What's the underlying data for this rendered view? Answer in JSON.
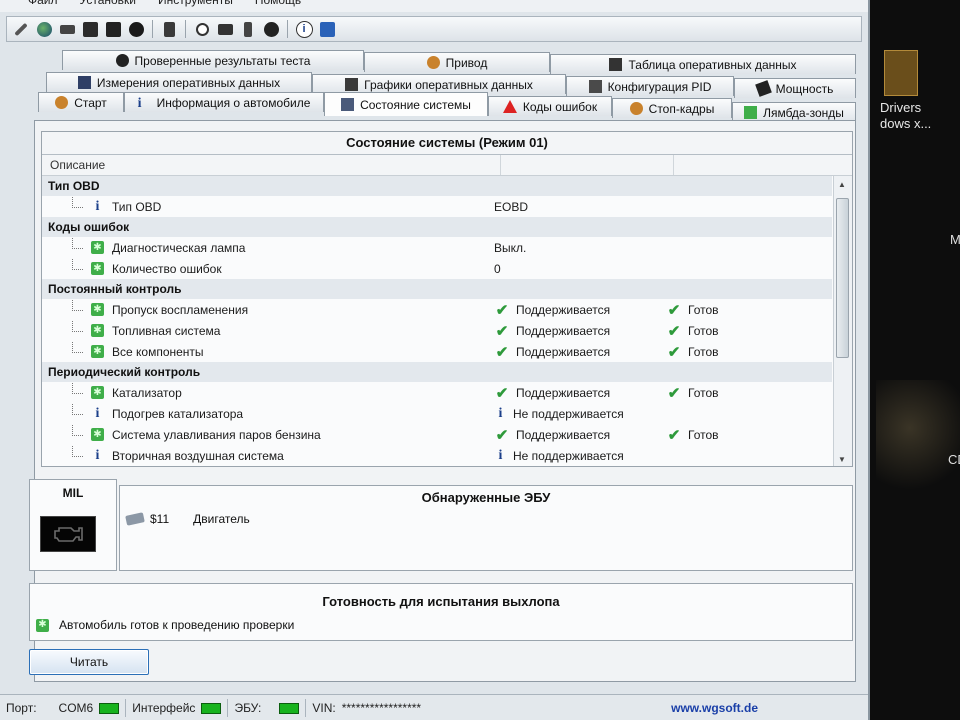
{
  "menu": [
    "Файл",
    "Установки",
    "Инструменты",
    "Помощь"
  ],
  "tabs": {
    "row1": [
      {
        "label": "Проверенные результаты теста",
        "icon": "test-results-icon"
      },
      {
        "label": "Привод",
        "icon": "drive-icon"
      },
      {
        "label": "Таблица оперативных данных",
        "icon": "table-icon"
      }
    ],
    "row2": [
      {
        "label": "Измерения оперативных данных",
        "icon": "measurement-icon"
      },
      {
        "label": "Графики оперативных данных",
        "icon": "graph-icon"
      },
      {
        "label": "Конфигурация PID",
        "icon": "pid-config-icon"
      },
      {
        "label": "Мощность",
        "icon": "power-icon"
      }
    ],
    "row3": [
      {
        "label": "Старт",
        "icon": "start-icon"
      },
      {
        "label": "Информация о автомобиле",
        "icon": "info-icon"
      },
      {
        "label": "Состояние системы",
        "icon": "system-status-icon",
        "active": true
      },
      {
        "label": "Коды ошибок",
        "icon": "warning-icon"
      },
      {
        "label": "Стоп-кадры",
        "icon": "freeze-frame-icon"
      },
      {
        "label": "Лямбда-зонды",
        "icon": "lambda-icon"
      }
    ]
  },
  "status": {
    "title": "Состояние системы (Режим 01)",
    "column_header": "Описание",
    "groups": [
      {
        "label": "Тип OBD",
        "rows": [
          {
            "icon": "info",
            "desc": "Тип OBD",
            "value": "EOBD",
            "value_check": false,
            "ready": "",
            "ready_check": false
          }
        ]
      },
      {
        "label": "Коды ошибок",
        "rows": [
          {
            "icon": "green",
            "desc": "Диагностическая лампа",
            "value": "Выкл.",
            "value_check": false,
            "ready": "",
            "ready_check": false
          },
          {
            "icon": "green",
            "desc": "Количество ошибок",
            "value": "0",
            "value_check": false,
            "ready": "",
            "ready_check": false
          }
        ]
      },
      {
        "label": "Постоянный контроль",
        "rows": [
          {
            "icon": "green",
            "desc": "Пропуск воспламенения",
            "value": "Поддерживается",
            "value_check": true,
            "ready": "Готов",
            "ready_check": true
          },
          {
            "icon": "green",
            "desc": "Топливная система",
            "value": "Поддерживается",
            "value_check": true,
            "ready": "Готов",
            "ready_check": true
          },
          {
            "icon": "green",
            "desc": "Все компоненты",
            "value": "Поддерживается",
            "value_check": true,
            "ready": "Готов",
            "ready_check": true
          }
        ]
      },
      {
        "label": "Периодический контроль",
        "rows": [
          {
            "icon": "green",
            "desc": "Катализатор",
            "value": "Поддерживается",
            "value_check": true,
            "ready": "Готов",
            "ready_check": true
          },
          {
            "icon": "info",
            "desc": "Подогрев катализатора",
            "value": "Не поддерживается",
            "value_check": false,
            "value_info": true,
            "ready": "",
            "ready_check": false
          },
          {
            "icon": "green",
            "desc": "Система улавливания паров бензина",
            "value": "Поддерживается",
            "value_check": true,
            "ready": "Готов",
            "ready_check": true
          },
          {
            "icon": "info",
            "desc": "Вторичная воздушная система",
            "value": "Не поддерживается",
            "value_check": false,
            "value_info": true,
            "ready": "",
            "ready_check": false
          }
        ]
      }
    ]
  },
  "mil": {
    "title": "MIL"
  },
  "ecu": {
    "title": "Обнаруженные ЭБУ",
    "address": "$11",
    "name": "Двигатель"
  },
  "exhaust": {
    "title": "Готовность для испытания выхлопа",
    "message": "Автомобиль готов к проведению проверки"
  },
  "read_button": "Читать",
  "statusbar": {
    "port_label": "Порт:",
    "port_value": "COM6",
    "interface_label": "Интерфейс",
    "ecu_label": "ЭБУ:",
    "vin_label": "VIN:",
    "vin_value": "*****************",
    "url": "www.wgsoft.de"
  },
  "desktop": {
    "icon_label_1": "Drivers",
    "icon_label_2": "dows x...",
    "right_m": "M",
    "right_c": "CD"
  },
  "colors": {
    "accent": "#2b6fb7",
    "ok_green": "#2e9a3b",
    "led_green": "#18b31e",
    "link_blue": "#1a3fa8"
  }
}
